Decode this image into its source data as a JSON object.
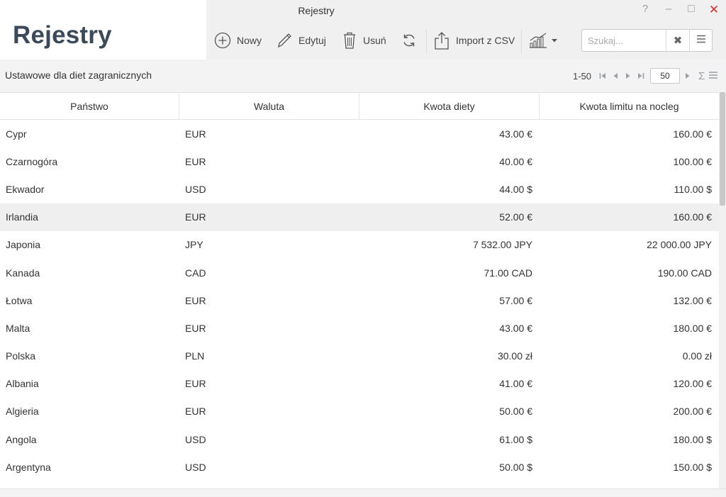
{
  "app": {
    "brand_title": "Rejestry",
    "window_title": "Rejestry",
    "window_controls": {
      "help": "?",
      "minimize": "–",
      "maximize": "□",
      "close": "✕"
    }
  },
  "toolbar": {
    "new_label": "Nowy",
    "edit_label": "Edytuj",
    "delete_label": "Usuń",
    "import_label": "Import z CSV",
    "search_placeholder": "Szukaj...",
    "search_clear": "✖",
    "icons": [
      "plus-circle-icon",
      "pencil-icon",
      "trash-icon",
      "refresh-icon",
      "export-icon",
      "chart-icon",
      "hamburger-icon"
    ]
  },
  "subheader": {
    "title": "Ustawowe dla diet zagranicznych",
    "pager": {
      "range": "1-50",
      "page_size": "50",
      "sum_symbol": "Σ"
    }
  },
  "table": {
    "columns": [
      "Państwo",
      "Waluta",
      "Kwota diety",
      "Kwota limitu na nocleg"
    ],
    "rows": [
      [
        "Cypr",
        "EUR",
        "43.00 €",
        "160.00 €"
      ],
      [
        "Czarnogóra",
        "EUR",
        "40.00 €",
        "100.00 €"
      ],
      [
        "Ekwador",
        "USD",
        "44.00 $",
        "110.00 $"
      ],
      [
        "Irlandia",
        "EUR",
        "52.00 €",
        "160.00 €"
      ],
      [
        "Japonia",
        "JPY",
        "7 532.00 JPY",
        "22 000.00 JPY"
      ],
      [
        "Kanada",
        "CAD",
        "71.00 CAD",
        "190.00 CAD"
      ],
      [
        "Łotwa",
        "EUR",
        "57.00 €",
        "132.00 €"
      ],
      [
        "Malta",
        "EUR",
        "43.00 €",
        "180.00 €"
      ],
      [
        "Polska",
        "PLN",
        "30.00 zł",
        "0.00 zł"
      ],
      [
        "Albania",
        "EUR",
        "41.00 €",
        "120.00 €"
      ],
      [
        "Algieria",
        "EUR",
        "50.00 €",
        "200.00 €"
      ],
      [
        "Angola",
        "USD",
        "61.00 $",
        "180.00 $"
      ],
      [
        "Argentyna",
        "USD",
        "50.00 $",
        "150.00 $"
      ]
    ],
    "selected_row": 3
  },
  "colors": {
    "brand_text": "#3b4a5a",
    "close_red": "#e02a2a",
    "selected_row": "#efefef",
    "toolbar_bg": "#f0f0f0"
  }
}
